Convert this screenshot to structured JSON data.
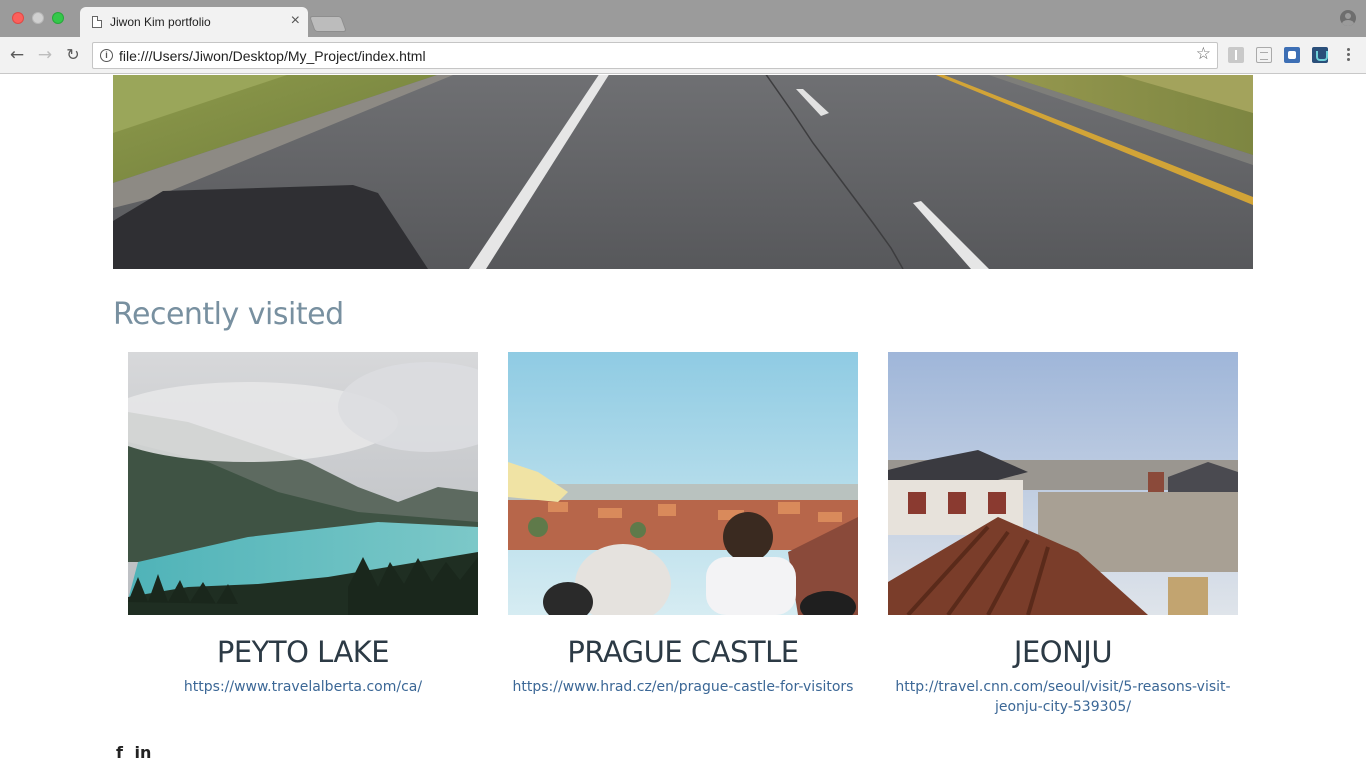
{
  "browser": {
    "tab_title": "Jiwon Kim portfolio",
    "tab_close": "×",
    "url": "file:///Users/Jiwon/Desktop/My_Project/index.html",
    "nav": {
      "back": "←",
      "forward": "→",
      "reload": "↻"
    },
    "star": "☆",
    "info": "i"
  },
  "page": {
    "section_title": "Recently visited",
    "cards": [
      {
        "title": "PEYTO LAKE",
        "link": "https://www.travelalberta.com/ca/"
      },
      {
        "title": "PRAGUE CASTLE",
        "link": "https://www.hrad.cz/en/prague-castle-for-visitors"
      },
      {
        "title": "JEONJU",
        "link": "http://travel.cnn.com/seoul/visit/5-reasons-visit-jeonju-city-539305/"
      }
    ],
    "social": {
      "facebook": "f",
      "linkedin": "in"
    }
  },
  "colors": {
    "section_title": "#7890a0",
    "card_title": "#2c3a45",
    "link": "#3b6796"
  }
}
